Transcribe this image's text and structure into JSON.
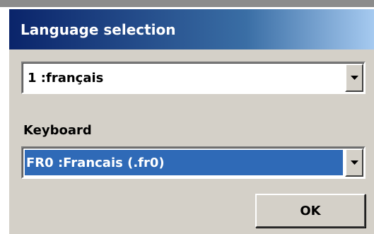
{
  "window": {
    "title": "Language selection"
  },
  "language": {
    "selected_value": "1 :français"
  },
  "keyboard": {
    "label": "Keyboard",
    "selected_value": "FR0 :Francais (.fr0)"
  },
  "buttons": {
    "ok_label": "OK"
  },
  "colors": {
    "face": "#d4d0c8",
    "titlebar_dark": "#0a246a",
    "titlebar_light": "#a6caf0",
    "selection": "#2f6ab7"
  },
  "icons": {
    "dropdown": "chevron-down-icon"
  }
}
